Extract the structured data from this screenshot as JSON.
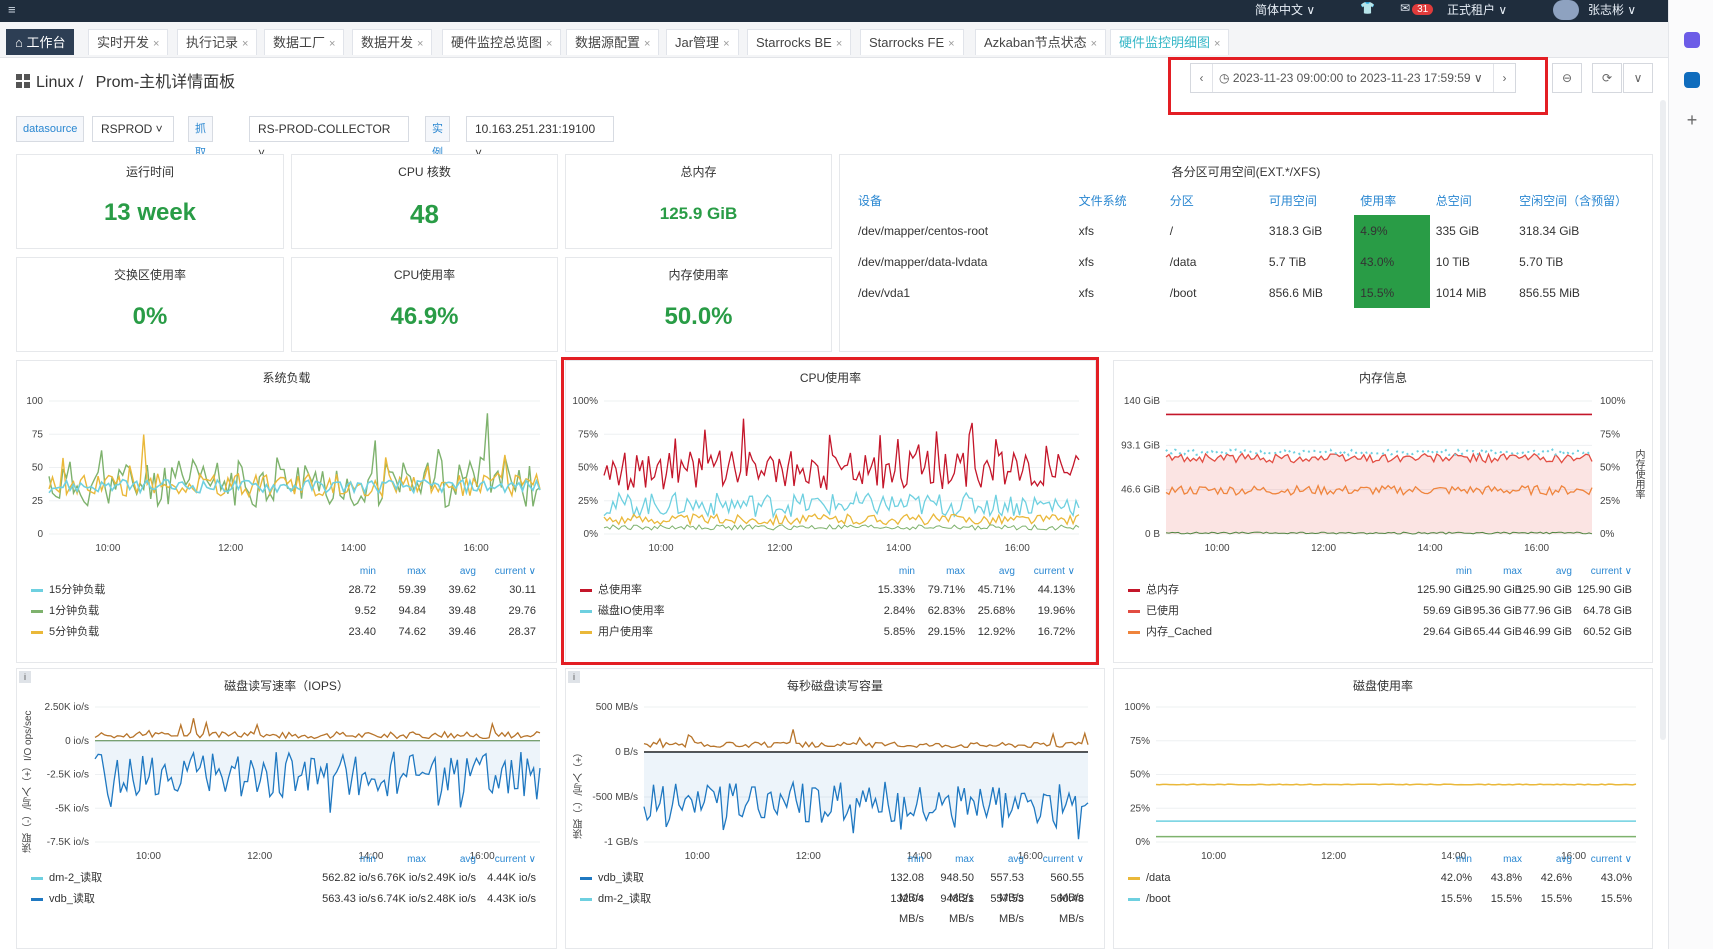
{
  "topbar": {
    "menu_icon": "≡",
    "lang": "简体中文 ∨",
    "notif_count": "31",
    "env": "正式租户 ∨",
    "user": "张志彬 ∨"
  },
  "tabs": [
    {
      "label": "工作台",
      "close": ""
    },
    {
      "label": "实时开发",
      "close": "×"
    },
    {
      "label": "执行记录",
      "close": "×"
    },
    {
      "label": "数据工厂",
      "close": "×"
    },
    {
      "label": "数据开发",
      "close": "×"
    },
    {
      "label": "硬件监控总览图",
      "close": "×"
    },
    {
      "label": "数据源配置",
      "close": "×"
    },
    {
      "label": "Jar管理",
      "close": "×"
    },
    {
      "label": "Starrocks BE",
      "close": "×"
    },
    {
      "label": "Starrocks FE",
      "close": "×"
    },
    {
      "label": "Azkaban节点状态",
      "close": "×"
    },
    {
      "label": "硬件监控明细图",
      "close": "×"
    }
  ],
  "breadcrumb": {
    "root": "Linux /",
    "page": "Prom-主机详情面板"
  },
  "timerange": "2023-11-23 09:00:00 to 2023-11-23 17:59:59",
  "vars": {
    "ds_label": "datasource",
    "ds_value": "RSPROD",
    "job_label": "抓取任务",
    "job_value": "RS-PROD-COLLECTOR",
    "inst_label": "实例",
    "inst_value": "10.163.251.231:19100"
  },
  "stats": {
    "uptime_title": "运行时间",
    "uptime": "13 week",
    "cpu_title": "CPU 核数",
    "cpu": "48",
    "mem_title": "总内存",
    "mem": "125.9 GiB",
    "swap_title": "交换区使用率",
    "swap": "0%",
    "cpuuse_title": "CPU使用率",
    "cpuuse": "46.9%",
    "memuse_title": "内存使用率",
    "memuse": "50.0%"
  },
  "disk": {
    "title": "各分区可用空间(EXT.*/XFS)",
    "headers": [
      "设备",
      "文件系统",
      "分区",
      "可用空间",
      "使用率",
      "总空间",
      "空闲空间（含预留）"
    ],
    "rows": [
      [
        "/dev/mapper/centos-root",
        "xfs",
        "/",
        "318.3 GiB",
        "4.9%",
        "335 GiB",
        "318.34 GiB"
      ],
      [
        "/dev/mapper/data-lvdata",
        "xfs",
        "/data",
        "5.7 TiB",
        "43.0%",
        "10 TiB",
        "5.70 TiB"
      ],
      [
        "/dev/vda1",
        "xfs",
        "/boot",
        "856.6 MiB",
        "15.5%",
        "1014 MiB",
        "856.55 MiB"
      ]
    ]
  },
  "legend_head": {
    "min": "min",
    "max": "max",
    "avg": "avg",
    "current": "current ∨"
  },
  "load": {
    "title": "系统负载",
    "rows": [
      {
        "name": "15分钟负载",
        "min": "28.72",
        "max": "59.39",
        "avg": "39.62",
        "current": "30.11"
      },
      {
        "name": "1分钟负载",
        "min": "9.52",
        "max": "94.84",
        "avg": "39.48",
        "current": "29.76"
      },
      {
        "name": "5分钟负载",
        "min": "23.40",
        "max": "74.62",
        "avg": "39.46",
        "current": "28.37"
      }
    ]
  },
  "cpu": {
    "title": "CPU使用率",
    "rows": [
      {
        "name": "总使用率",
        "min": "15.33%",
        "max": "79.71%",
        "avg": "45.71%",
        "current": "44.13%"
      },
      {
        "name": "磁盘IO使用率",
        "min": "2.84%",
        "max": "62.83%",
        "avg": "25.68%",
        "current": "19.96%"
      },
      {
        "name": "用户使用率",
        "min": "5.85%",
        "max": "29.15%",
        "avg": "12.92%",
        "current": "16.72%"
      }
    ]
  },
  "mem": {
    "title": "内存信息",
    "right_axis": "内存使用率",
    "rows": [
      {
        "name": "总内存",
        "min": "125.90 GiB",
        "max": "125.90 GiB",
        "avg": "125.90 GiB",
        "current": "125.90 GiB"
      },
      {
        "name": "已使用",
        "min": "59.69 GiB",
        "max": "95.36 GiB",
        "avg": "77.96 GiB",
        "current": "64.78 GiB"
      },
      {
        "name": "内存_Cached",
        "min": "29.64 GiB",
        "max": "65.44 GiB",
        "avg": "46.99 GiB",
        "current": "60.52 GiB"
      }
    ]
  },
  "iops": {
    "title": "磁盘读写速率（IOPS）",
    "yaxis": "读取（-）/写入（+）I/O ops/sec",
    "rows": [
      {
        "name": "dm-2_读取",
        "min": "562.82 io/s",
        "max": "6.76K io/s",
        "avg": "2.49K io/s",
        "current": "4.44K io/s"
      },
      {
        "name": "vdb_读取",
        "min": "563.43 io/s",
        "max": "6.74K io/s",
        "avg": "2.48K io/s",
        "current": "4.43K io/s"
      }
    ]
  },
  "bw": {
    "title": "每秒磁盘读写容量",
    "yaxis": "读取（-）/写入（+）",
    "rows": [
      {
        "name": "vdb_读取",
        "min": "132.08 MB/s",
        "max": "948.50 MB/s",
        "avg": "557.53 MB/s",
        "current": "560.55 MB/s"
      },
      {
        "name": "dm-2_读取",
        "min": "132.04 MB/s",
        "max": "948.21 MB/s",
        "avg": "557.53 MB/s",
        "current": "560.48 MB/s"
      }
    ]
  },
  "diskuse": {
    "title": "磁盘使用率",
    "rows": [
      {
        "name": "/data",
        "min": "42.0%",
        "max": "43.8%",
        "avg": "42.6%",
        "current": "43.0%"
      },
      {
        "name": "/boot",
        "min": "15.5%",
        "max": "15.5%",
        "avg": "15.5%",
        "current": "15.5%"
      }
    ]
  },
  "xticks": [
    "10:00",
    "12:00",
    "14:00",
    "16:00"
  ],
  "chart_data": [
    {
      "type": "line",
      "title": "系统负载",
      "yticks": [
        "100",
        "75",
        "50",
        "25",
        "0"
      ],
      "ylim": [
        0,
        100
      ],
      "series": [
        {
          "name": "15分钟负载",
          "color": "#6ed0e0",
          "avg": 39.62
        },
        {
          "name": "1分钟负载",
          "color": "#7eb26d",
          "avg": 39.48
        },
        {
          "name": "5分钟负载",
          "color": "#eab839",
          "avg": 39.46
        }
      ]
    },
    {
      "type": "line",
      "title": "CPU使用率",
      "yticks": [
        "100%",
        "75%",
        "50%",
        "25%",
        "0%"
      ],
      "ylim": [
        0,
        100
      ],
      "series": [
        {
          "name": "总使用率",
          "color": "#c4162a",
          "avg": 45.71
        },
        {
          "name": "磁盘IO使用率",
          "color": "#6ed0e0",
          "avg": 25.68
        },
        {
          "name": "用户使用率",
          "color": "#eab839",
          "avg": 12.92
        }
      ]
    },
    {
      "type": "line",
      "title": "内存信息",
      "yticks": [
        "140 GiB",
        "93.1 GiB",
        "46.6 GiB",
        "0 B"
      ],
      "yticks_right": [
        "100%",
        "75%",
        "50%",
        "25%",
        "0%"
      ],
      "series": [
        {
          "name": "总内存",
          "color": "#c4162a",
          "avg": 125.9
        },
        {
          "name": "已使用",
          "color": "#e24d42",
          "avg": 77.96
        },
        {
          "name": "内存_Cached",
          "color": "#ef843c",
          "avg": 46.99
        }
      ]
    },
    {
      "type": "line",
      "title": "磁盘读写速率（IOPS）",
      "yticks": [
        "2.50K io/s",
        "0 io/s",
        "-2.5K io/s",
        "-5K io/s",
        "-7.5K io/s"
      ],
      "series": [
        {
          "name": "dm-2_读取",
          "color": "#6ed0e0",
          "avg": -2490
        },
        {
          "name": "vdb_读取",
          "color": "#1f78c1",
          "avg": -2480
        }
      ]
    },
    {
      "type": "line",
      "title": "每秒磁盘读写容量",
      "yticks": [
        "500 MB/s",
        "0 B/s",
        "-500 MB/s",
        "-1 GB/s"
      ],
      "series": [
        {
          "name": "vdb_读取",
          "color": "#1f78c1",
          "avg": -557.53
        },
        {
          "name": "dm-2_读取",
          "color": "#6ed0e0",
          "avg": -557.53
        }
      ]
    },
    {
      "type": "line",
      "title": "磁盘使用率",
      "yticks": [
        "100%",
        "75%",
        "50%",
        "25%",
        "0%"
      ],
      "ylim": [
        0,
        100
      ],
      "series": [
        {
          "name": "/data",
          "color": "#eab839",
          "avg": 42.6
        },
        {
          "name": "/boot",
          "color": "#6ed0e0",
          "avg": 15.5
        }
      ]
    }
  ]
}
